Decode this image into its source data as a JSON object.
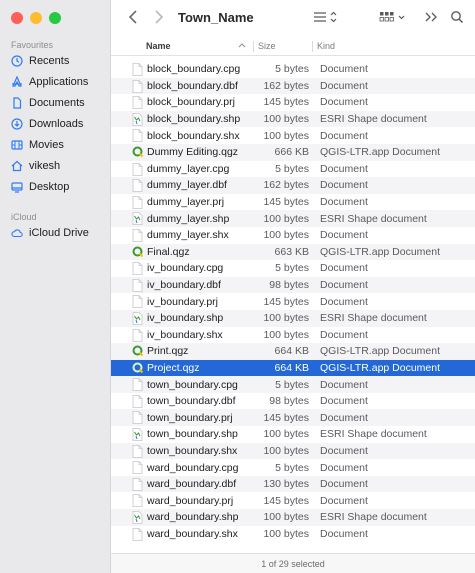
{
  "window": {
    "title": "Town_Name"
  },
  "colors": {
    "close": "#fe5f57",
    "minimize": "#febc2e",
    "zoom": "#28c840",
    "accent": "#2468d8",
    "qgis_green": "#3a9a31"
  },
  "sidebar": {
    "favourites_label": "Favourites",
    "favourites": [
      {
        "label": "Recents",
        "icon": "clock-icon"
      },
      {
        "label": "Applications",
        "icon": "applications-icon"
      },
      {
        "label": "Documents",
        "icon": "document-icon"
      },
      {
        "label": "Downloads",
        "icon": "download-icon"
      },
      {
        "label": "Movies",
        "icon": "film-icon"
      },
      {
        "label": "vikesh",
        "icon": "home-icon"
      },
      {
        "label": "Desktop",
        "icon": "desktop-icon"
      }
    ],
    "icloud_label": "iCloud",
    "icloud": [
      {
        "label": "iCloud Drive",
        "icon": "cloud-icon"
      }
    ]
  },
  "table": {
    "headers": {
      "name": "Name",
      "size": "Size",
      "kind": "Kind"
    },
    "rows": [
      {
        "name": "block_boundary.cpg",
        "size": "5 bytes",
        "kind": "Document",
        "icon": "doc"
      },
      {
        "name": "block_boundary.dbf",
        "size": "162 bytes",
        "kind": "Document",
        "icon": "doc"
      },
      {
        "name": "block_boundary.prj",
        "size": "145 bytes",
        "kind": "Document",
        "icon": "doc"
      },
      {
        "name": "block_boundary.shp",
        "size": "100 bytes",
        "kind": "ESRI Shape document",
        "icon": "shp"
      },
      {
        "name": "block_boundary.shx",
        "size": "100 bytes",
        "kind": "Document",
        "icon": "doc"
      },
      {
        "name": "Dummy Editing.qgz",
        "size": "666 KB",
        "kind": "QGIS-LTR.app Document",
        "icon": "qgz"
      },
      {
        "name": "dummy_layer.cpg",
        "size": "5 bytes",
        "kind": "Document",
        "icon": "doc"
      },
      {
        "name": "dummy_layer.dbf",
        "size": "162 bytes",
        "kind": "Document",
        "icon": "doc"
      },
      {
        "name": "dummy_layer.prj",
        "size": "145 bytes",
        "kind": "Document",
        "icon": "doc"
      },
      {
        "name": "dummy_layer.shp",
        "size": "100 bytes",
        "kind": "ESRI Shape document",
        "icon": "shp"
      },
      {
        "name": "dummy_layer.shx",
        "size": "100 bytes",
        "kind": "Document",
        "icon": "doc"
      },
      {
        "name": "Final.qgz",
        "size": "663 KB",
        "kind": "QGIS-LTR.app Document",
        "icon": "qgz"
      },
      {
        "name": "iv_boundary.cpg",
        "size": "5 bytes",
        "kind": "Document",
        "icon": "doc"
      },
      {
        "name": "iv_boundary.dbf",
        "size": "98 bytes",
        "kind": "Document",
        "icon": "doc"
      },
      {
        "name": "iv_boundary.prj",
        "size": "145 bytes",
        "kind": "Document",
        "icon": "doc"
      },
      {
        "name": "iv_boundary.shp",
        "size": "100 bytes",
        "kind": "ESRI Shape document",
        "icon": "shp"
      },
      {
        "name": "iv_boundary.shx",
        "size": "100 bytes",
        "kind": "Document",
        "icon": "doc"
      },
      {
        "name": "Print.qgz",
        "size": "664 KB",
        "kind": "QGIS-LTR.app Document",
        "icon": "qgz"
      },
      {
        "name": "Project.qgz",
        "size": "664 KB",
        "kind": "QGIS-LTR.app Document",
        "icon": "qgz",
        "selected": true
      },
      {
        "name": "town_boundary.cpg",
        "size": "5 bytes",
        "kind": "Document",
        "icon": "doc"
      },
      {
        "name": "town_boundary.dbf",
        "size": "98 bytes",
        "kind": "Document",
        "icon": "doc"
      },
      {
        "name": "town_boundary.prj",
        "size": "145 bytes",
        "kind": "Document",
        "icon": "doc"
      },
      {
        "name": "town_boundary.shp",
        "size": "100 bytes",
        "kind": "ESRI Shape document",
        "icon": "shp"
      },
      {
        "name": "town_boundary.shx",
        "size": "100 bytes",
        "kind": "Document",
        "icon": "doc"
      },
      {
        "name": "ward_boundary.cpg",
        "size": "5 bytes",
        "kind": "Document",
        "icon": "doc"
      },
      {
        "name": "ward_boundary.dbf",
        "size": "130 bytes",
        "kind": "Document",
        "icon": "doc"
      },
      {
        "name": "ward_boundary.prj",
        "size": "145 bytes",
        "kind": "Document",
        "icon": "doc"
      },
      {
        "name": "ward_boundary.shp",
        "size": "100 bytes",
        "kind": "ESRI Shape document",
        "icon": "shp"
      },
      {
        "name": "ward_boundary.shx",
        "size": "100 bytes",
        "kind": "Document",
        "icon": "doc"
      }
    ]
  },
  "status": {
    "text": "1 of 29 selected"
  }
}
